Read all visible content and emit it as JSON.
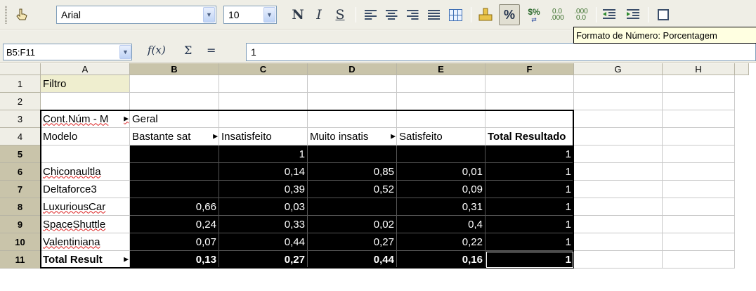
{
  "toolbar": {
    "font_name": "Arial",
    "font_size": "10",
    "bold_label": "N",
    "italic_label": "I",
    "underline_label": "S",
    "percent_label": "%",
    "currency_label": "$%",
    "add_decimal_top": "0.0",
    "add_decimal_bottom": ".000",
    "del_decimal_top": ".000",
    "del_decimal_bottom": "0.0",
    "icons": [
      "drag-handle-icon",
      "font-name-dropdown",
      "font-size-dropdown",
      "bold-icon",
      "italic-icon",
      "underline-icon",
      "align-left-icon",
      "align-center-icon",
      "align-right-icon",
      "justify-icon",
      "merge-cells-icon",
      "currency-icon",
      "percent-icon",
      "standard-format-icon",
      "add-decimal-icon",
      "delete-decimal-icon",
      "decrease-indent-icon",
      "increase-indent-icon",
      "borders-icon"
    ]
  },
  "formula": {
    "name_box": "B5:F11",
    "fx_label": "f(x)",
    "sum_label": "Σ",
    "equals_label": "=",
    "content": "1"
  },
  "tooltip": "Formato de Número: Porcentagem",
  "columns": [
    "A",
    "B",
    "C",
    "D",
    "E",
    "F",
    "G",
    "H"
  ],
  "rows": [
    "1",
    "2",
    "3",
    "4",
    "5",
    "6",
    "7",
    "8",
    "9",
    "10",
    "11"
  ],
  "cells": {
    "A1": "Filtro",
    "A3": "Cont.Núm - M",
    "B3": "Geral",
    "A4": "Modelo",
    "B4": "Bastante sat",
    "C4": "Insatisfeito",
    "D4": "Muito insatis",
    "E4": "Satisfeito",
    "F4": "Total Resultado",
    "C5": "1",
    "F5": "1",
    "A6": "Chiconaultla",
    "C6": "0,14",
    "D6": "0,85",
    "E6": "0,01",
    "F6": "1",
    "A7": "Deltaforce3",
    "C7": "0,39",
    "D7": "0,52",
    "E7": "0,09",
    "F7": "1",
    "A8": "LuxuriousCar",
    "B8": "0,66",
    "C8": "0,03",
    "E8": "0,31",
    "F8": "1",
    "A9": "SpaceShuttle",
    "B9": "0,24",
    "C9": "0,33",
    "D9": "0,02",
    "E9": "0,4",
    "F9": "1",
    "A10": "Valentiniana",
    "B10": "0,07",
    "C10": "0,44",
    "D10": "0,27",
    "E10": "0,22",
    "F10": "1",
    "A11": "Total Result",
    "B11": "0,13",
    "C11": "0,27",
    "D11": "0,44",
    "E11": "0,16",
    "F11": "1"
  },
  "colors": {
    "selection": "#000000",
    "header_bg": "#efeee6",
    "header_selected": "#c9c4aa",
    "tooltip_bg": "#ffffe1"
  }
}
